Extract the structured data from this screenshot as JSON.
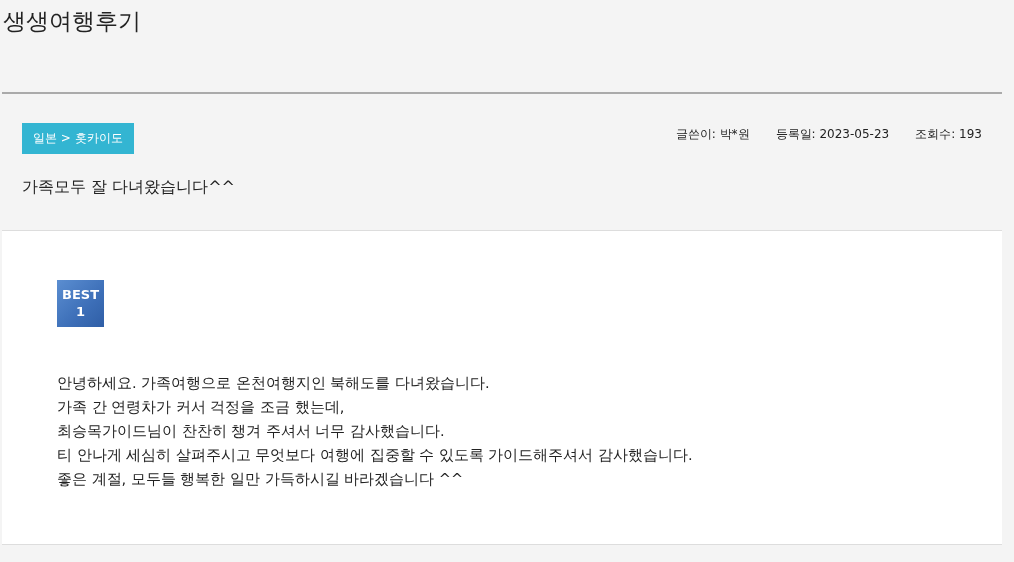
{
  "page_title": "생생여행후기",
  "post": {
    "category": "일본 > 홋카이도",
    "meta": [
      {
        "label": "글쓴이:",
        "value": "박*원"
      },
      {
        "label": "등록일:",
        "value": "2023-05-23"
      },
      {
        "label": "조회수:",
        "value": "193"
      }
    ],
    "subject": "가족모두 잘 다녀왔습니다^^",
    "badge": {
      "label": "BEST",
      "rank": "1"
    },
    "body": [
      "안녕하세요. 가족여행으로 온천여행지인 북해도를 다녀왔습니다.",
      "가족 간 연령차가 커서 걱정을 조금 했는데,",
      "최승목가이드님이 찬찬히 챙겨 주셔서 너무 감사했습니다.",
      "티 안나게 세심히 살펴주시고 무엇보다 여행에 집중할 수 있도록 가이드해주셔서 감사했습니다.",
      "좋은 계절, 모두들 행복한 일만 가득하시길 바라겠습니다 ^^"
    ]
  }
}
